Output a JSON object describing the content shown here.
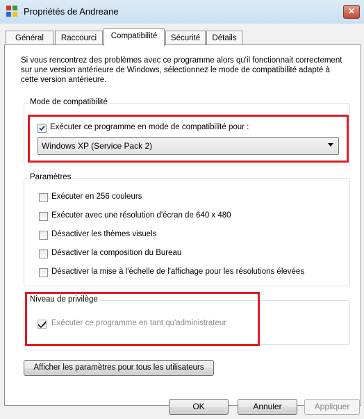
{
  "window": {
    "title": "Propriétés de Andreane",
    "close_label": "✕"
  },
  "tabs": [
    {
      "label": "Général"
    },
    {
      "label": "Raccourci"
    },
    {
      "label": "Compatibilité"
    },
    {
      "label": "Sécurité"
    },
    {
      "label": "Détails"
    }
  ],
  "active_tab": "Compatibilité",
  "intro": "Si vous rencontrez des problèmes avec ce programme alors qu'il fonctionnait correctement sur une version antérieure de Windows, sélectionnez le mode de compatibilité adapté à cette version antérieure.",
  "compat_mode": {
    "group_label": "Mode de compatibilité",
    "checkbox_label": "Exécuter ce programme en mode de compatibilité pour :",
    "checked": true,
    "selected_os": "Windows XP (Service Pack 2)"
  },
  "settings": {
    "group_label": "Paramètres",
    "items": [
      {
        "label": "Exécuter en 256 couleurs",
        "checked": false
      },
      {
        "label": "Exécuter avec une résolution d'écran de 640 x 480",
        "checked": false
      },
      {
        "label": "Désactiver les thèmes visuels",
        "checked": false
      },
      {
        "label": "Désactiver la composition du Bureau",
        "checked": false
      },
      {
        "label": "Désactiver la mise à l'échelle de l'affichage pour les résolutions élevées",
        "checked": false
      }
    ]
  },
  "privilege": {
    "group_label": "Niveau de privilège",
    "checkbox_label": "Exécuter ce programme en tant qu'administrateur",
    "checked": true,
    "disabled": true
  },
  "all_users_button": "Afficher les paramètres pour tous les utilisateurs",
  "buttons": {
    "ok": "OK",
    "cancel": "Annuler",
    "apply": "Appliquer"
  },
  "colors": {
    "highlight_box": "#e01b24",
    "titlebar": "#c9dff2"
  }
}
